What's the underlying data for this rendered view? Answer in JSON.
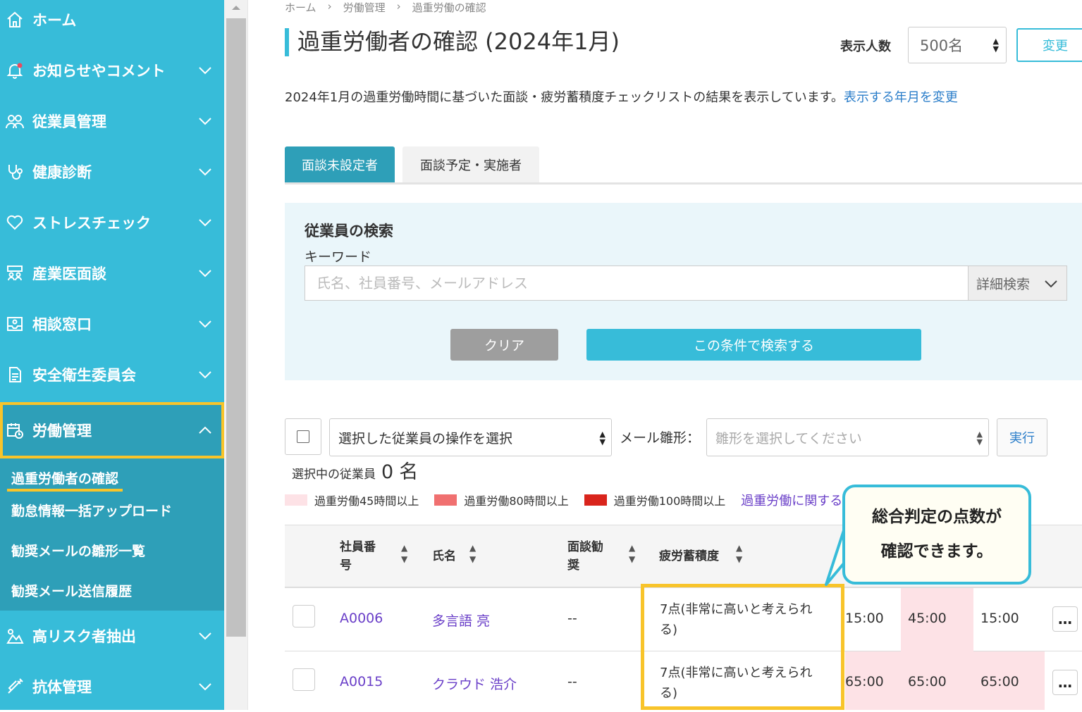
{
  "sidebar": {
    "items": [
      {
        "label": "ホーム",
        "icon": "home-icon"
      },
      {
        "label": "お知らせやコメント",
        "icon": "bell-icon"
      },
      {
        "label": "従業員管理",
        "icon": "users-icon"
      },
      {
        "label": "健康診断",
        "icon": "stethoscope-icon"
      },
      {
        "label": "ストレスチェック",
        "icon": "heart-icon"
      },
      {
        "label": "産業医面談",
        "icon": "meeting-icon"
      },
      {
        "label": "相談窓口",
        "icon": "inbox-icon"
      },
      {
        "label": "安全衛生委員会",
        "icon": "document-icon"
      },
      {
        "label": "労働管理",
        "icon": "calendar-clock-icon"
      },
      {
        "label": "高リスク者抽出",
        "icon": "risk-icon"
      },
      {
        "label": "抗体管理",
        "icon": "syringe-icon"
      }
    ],
    "submenu": [
      {
        "label": "過重労働者の確認"
      },
      {
        "label": "勤怠情報一括アップロード"
      },
      {
        "label": "勧奨メールの雛形一覧"
      },
      {
        "label": "勧奨メール送信履歴"
      }
    ]
  },
  "breadcrumb": [
    "ホーム",
    "›",
    "労働管理",
    "›",
    "過重労働の確認"
  ],
  "page_title": "過重労働者の確認 (2024年1月)",
  "display_count": {
    "label": "表示人数",
    "value": "500名"
  },
  "change_button": "変更",
  "description": {
    "text": "2024年1月の過重労働時間に基づいた面談・疲労蓄積度チェックリストの結果を表示しています。",
    "link": "表示する年月を変更"
  },
  "tabs": [
    {
      "label": "面談未設定者",
      "active": true
    },
    {
      "label": "面談予定・実施者",
      "active": false
    }
  ],
  "search": {
    "heading": "従業員の検索",
    "keyword_label": "キーワード",
    "placeholder": "氏名、社員番号、メールアドレス",
    "detail_label": "詳細検索",
    "clear_label": "クリア",
    "submit_label": "この条件で検索する"
  },
  "bulk": {
    "operation_placeholder": "選択した従業員の操作を選択",
    "mail_template_label": "メール雛形：",
    "mail_template_placeholder": "雛形を選択してください",
    "execute_label": "実行",
    "selected_prefix": "選択中の従業員",
    "selected_count": "0",
    "selected_suffix": "名"
  },
  "legend": {
    "items": [
      {
        "label": "過重労働45時間以上",
        "color": "#fde2e6"
      },
      {
        "label": "過重労働80時間以上",
        "color": "#f07070"
      },
      {
        "label": "過重労働100時間以上",
        "color": "#d9241c"
      }
    ],
    "link": "過重労働に関する"
  },
  "table": {
    "headers": {
      "employee_id": [
        "社員番",
        "号"
      ],
      "name": "氏名",
      "interview": [
        "面談勧",
        "奨"
      ],
      "fatigue": "疲労蓄積度"
    },
    "rows": [
      {
        "id": "A0006",
        "name": "多言語 亮",
        "interview": "--",
        "fatigue": [
          "7点(非常に高いと考えられ",
          "る)"
        ],
        "v1": "15:00",
        "v2": "45:00",
        "v3": "15:00"
      },
      {
        "id": "A0015",
        "name": "クラウド 浩介",
        "interview": "--",
        "fatigue": [
          "7点(非常に高いと考えられ",
          "る)"
        ],
        "v1": "65:00",
        "v2": "65:00",
        "v3": "65:00"
      }
    ],
    "more_label": "…"
  },
  "callout": {
    "line1": "総合判定の点数が",
    "line2": "確認できます。"
  },
  "colors": {
    "sidebar": "#37bcd9",
    "sidebar_active": "#2e9fb8",
    "highlight": "#f8c42a",
    "link": "#2a7dc9",
    "link_purple": "#6a3fc8",
    "overtime_45": "#fde2e6"
  }
}
